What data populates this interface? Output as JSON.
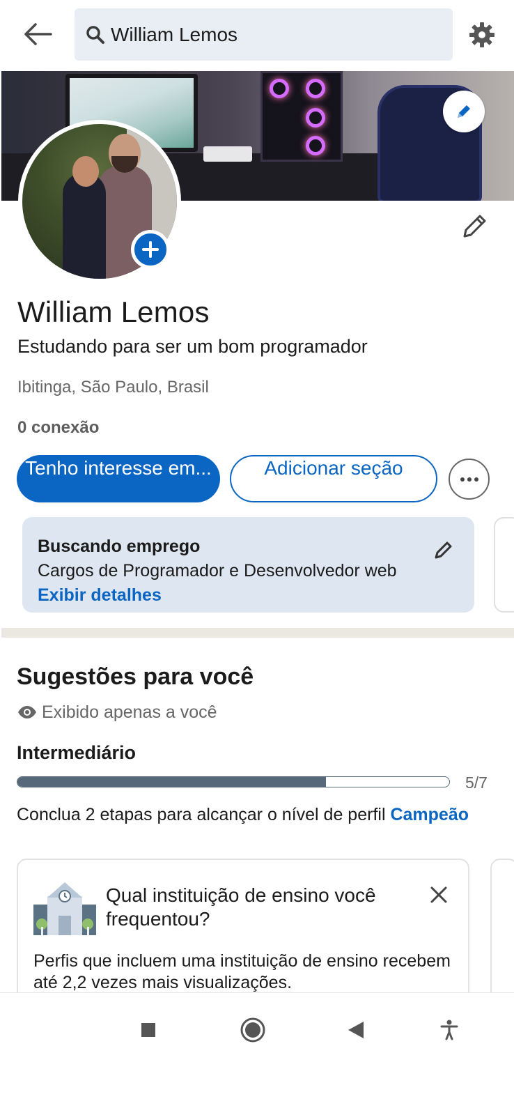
{
  "topbar": {
    "search_value": "William Lemos"
  },
  "profile": {
    "name": "William Lemos",
    "headline": "Estudando para ser um bom programador",
    "location": "Ibitinga, São Paulo, Brasil",
    "connections": "0 conexão"
  },
  "actions": {
    "primary_label": "Tenho interesse em...",
    "secondary_label": "Adicionar seção"
  },
  "open_to_work": {
    "title": "Buscando emprego",
    "description": "Cargos de Programador e Desenvolvedor web",
    "link": "Exibir detalhes"
  },
  "suggestions": {
    "title": "Sugestões para você",
    "private_note": "Exibido apenas a você",
    "level": "Intermediário",
    "progress_count": "5/7",
    "progress_fraction": 0.714,
    "complete_text": "Conclua 2 etapas para alcançar o nível de perfil ",
    "complete_link": "Campeão",
    "card": {
      "title": "Qual instituição de ensino você frequentou?",
      "body": "Perfis que incluem uma instituição de ensino recebem até 2,2 vezes mais visualizações."
    }
  },
  "colors": {
    "brand_blue": "#0a66c2",
    "progress_gray": "#56687a",
    "card_bg": "#dde6f1"
  },
  "icons": {
    "back": "arrow-left-icon",
    "search": "search-icon",
    "settings": "gear-icon",
    "cover_edit": "pencil-icon",
    "avatar_add": "plus-icon",
    "more": "ellipsis-icon",
    "private": "eye-icon",
    "close": "close-icon",
    "school": "school-building-icon",
    "nav_recents": "square-icon",
    "nav_home": "circle-icon",
    "nav_back": "triangle-back-icon",
    "nav_accessibility": "accessibility-icon"
  }
}
